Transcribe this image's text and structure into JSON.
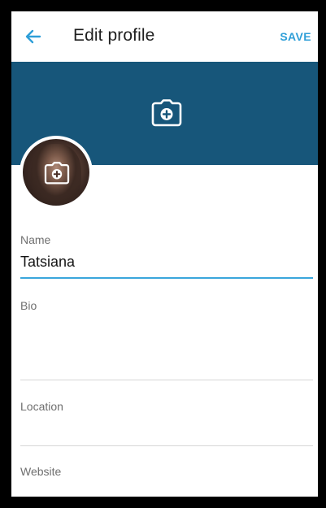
{
  "appbar": {
    "back_icon": "arrow-left-icon",
    "title": "Edit profile",
    "save_label": "SAVE"
  },
  "colors": {
    "accent": "#2f9fd8",
    "banner": "#17567a",
    "active_underline": "#3aa6dc"
  },
  "banner": {
    "icon": "camera-add-icon"
  },
  "avatar": {
    "icon": "camera-add-icon"
  },
  "form": {
    "name": {
      "label": "Name",
      "value": "Tatsiana"
    },
    "bio": {
      "label": "Bio",
      "value": ""
    },
    "location": {
      "label": "Location",
      "value": ""
    },
    "website": {
      "label": "Website",
      "value": ""
    }
  }
}
